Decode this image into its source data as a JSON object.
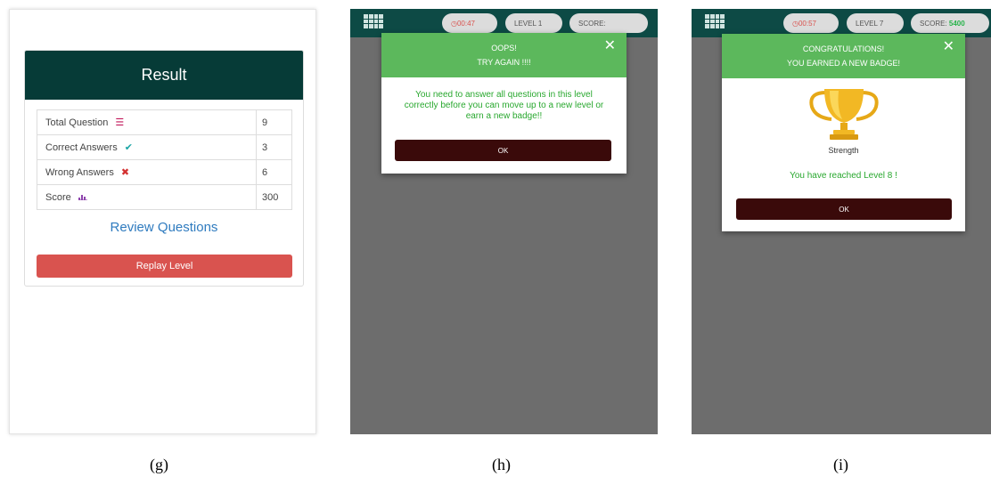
{
  "panel_g": {
    "result_title": "Result",
    "rows": [
      {
        "label": "Total Question",
        "value": "9",
        "icon": "list-icon",
        "icon_color": "#c2185b"
      },
      {
        "label": "Correct Answers",
        "value": "3",
        "icon": "check-icon",
        "icon_color": "#1aa5a5"
      },
      {
        "label": "Wrong Answers",
        "value": "6",
        "icon": "cross-icon",
        "icon_color": "#d32f2f"
      },
      {
        "label": "Score",
        "value": "300",
        "icon": "bar-chart-icon",
        "icon_color": "#8e44ad"
      }
    ],
    "review_link": "Review Questions",
    "replay_button": "Replay Level",
    "caption": "(g)"
  },
  "panel_h": {
    "timer": "00:47",
    "level": "LEVEL 1",
    "score_label": "SCORE:",
    "modal_title_1": "OOPS!",
    "modal_title_2": "TRY AGAIN !!!!",
    "modal_message": "You need to answer all questions in this level correctly before you can move up to a new level or earn a new badge!!",
    "ok_button": "OK",
    "caption": "(h)"
  },
  "panel_i": {
    "timer": "00:57",
    "level": "LEVEL 7",
    "score_label": "SCORE:",
    "score_value": "5400",
    "modal_title_1": "CONGRATULATIONS!",
    "modal_title_2": "YOU EARNED A NEW BADGE!",
    "badge_name": "Strength",
    "message": "You have reached Level 8 !",
    "ok_button": "OK",
    "caption": "(i)"
  },
  "colors": {
    "topbar": "#0d4a45",
    "modal_header": "#5cb85c",
    "ok_button": "#3a0a0a",
    "replay_button": "#d9534f"
  }
}
